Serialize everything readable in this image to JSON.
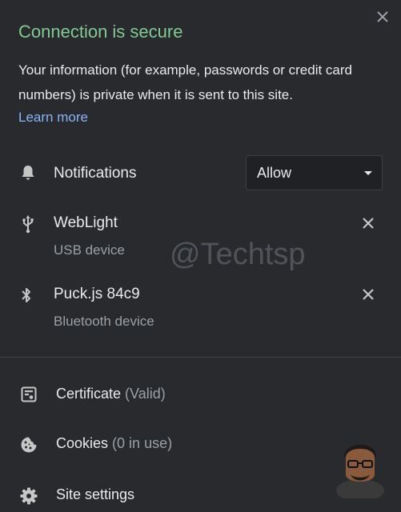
{
  "header": {
    "title": "Connection is secure",
    "description": "Your information (for example, passwords or credit card numbers) is private when it is sent to this site.",
    "learn_more": "Learn more",
    "close_icon": "close-icon"
  },
  "permissions": {
    "notifications": {
      "icon": "bell-icon",
      "label": "Notifications",
      "value": "Allow"
    }
  },
  "devices": [
    {
      "icon": "usb-icon",
      "name": "WebLight",
      "type": "USB device"
    },
    {
      "icon": "bluetooth-icon",
      "name": "Puck.js 84c9",
      "type": "Bluetooth device"
    }
  ],
  "links": {
    "certificate": {
      "icon": "certificate-icon",
      "label": "Certificate",
      "suffix": "(Valid)"
    },
    "cookies": {
      "icon": "cookie-icon",
      "label": "Cookies",
      "suffix": "(0 in use)"
    },
    "site_settings": {
      "icon": "gear-icon",
      "label": "Site settings"
    }
  },
  "watermark": "@Techtsp",
  "colors": {
    "background": "#292a2d",
    "secure_green": "#81c995",
    "link_blue": "#8ab4f8",
    "text": "#e8eaed",
    "muted": "#9aa0a6"
  }
}
